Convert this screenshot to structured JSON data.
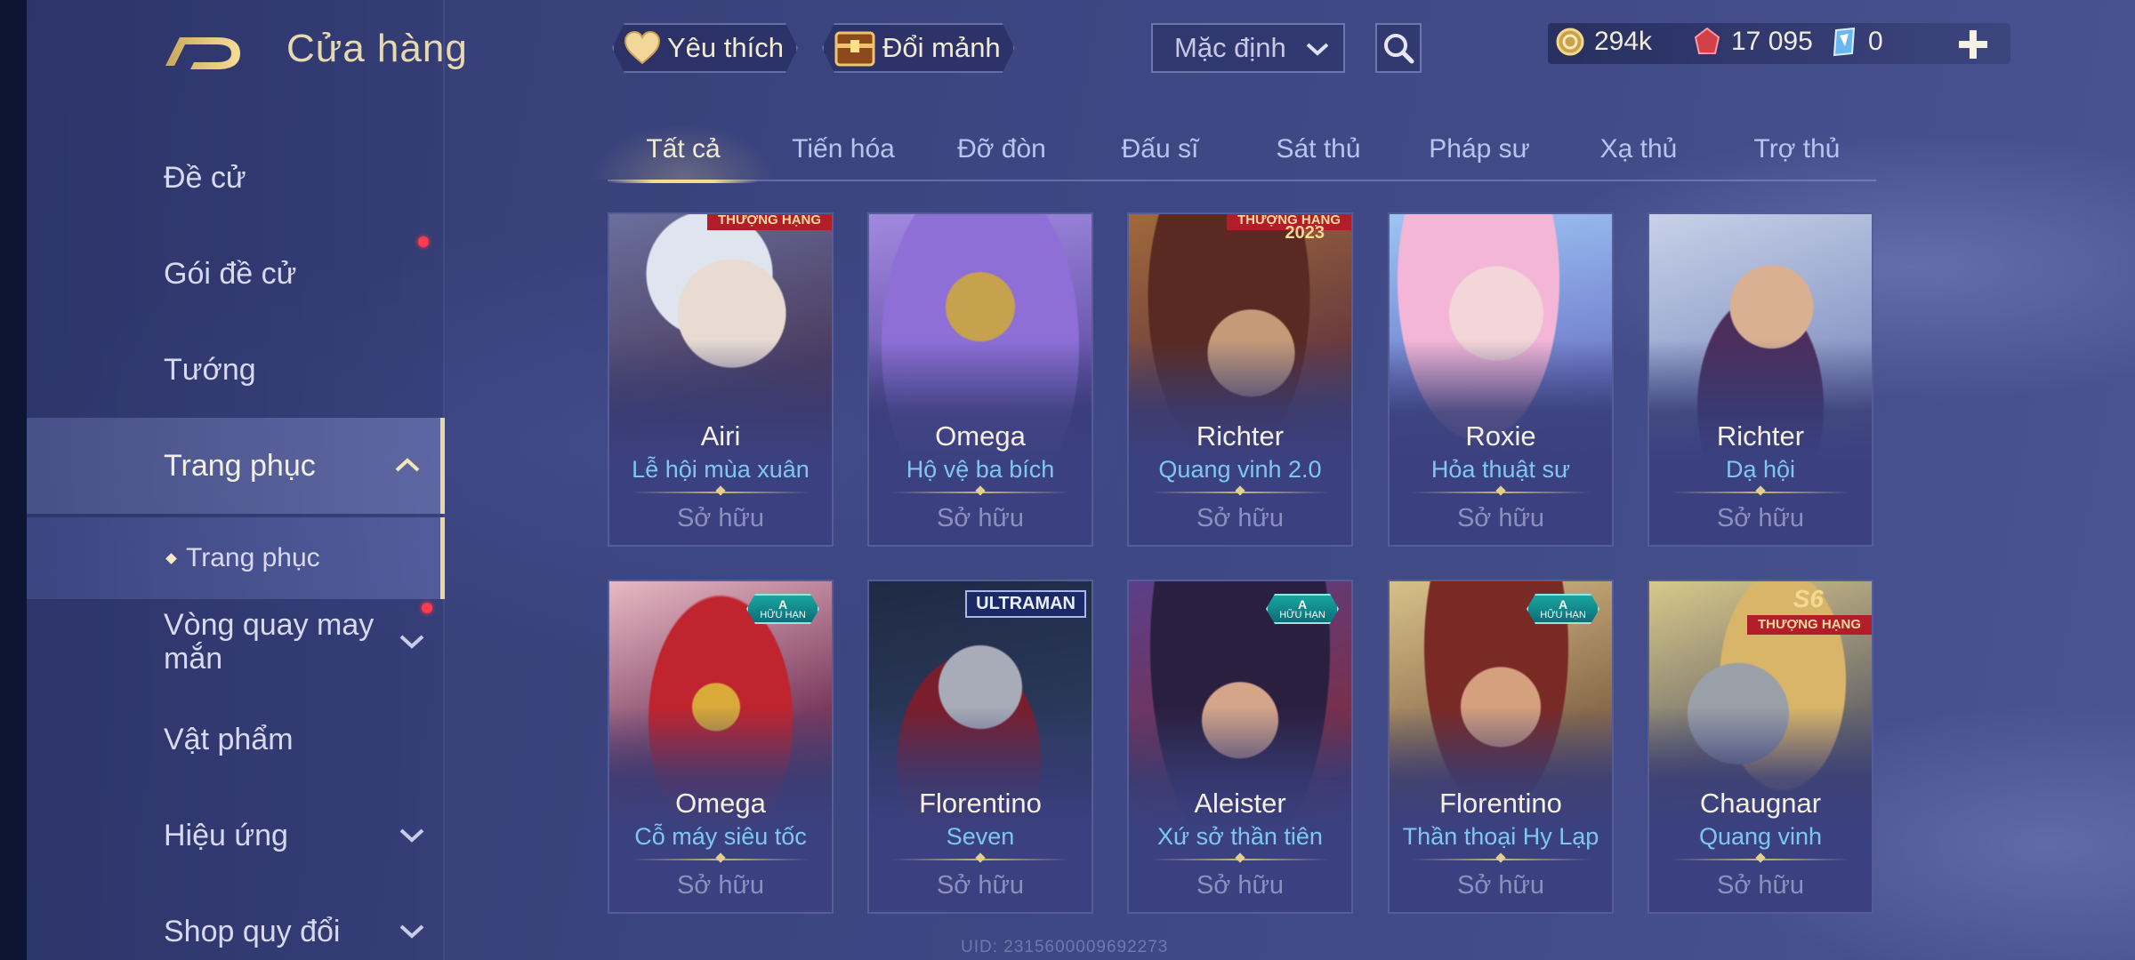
{
  "header": {
    "title": "Cửa hàng",
    "favorite_label": "Yêu thích",
    "exchange_label": "Đổi mảnh",
    "sort_select": "Mặc định"
  },
  "currency": {
    "gold": "294k",
    "vouchers": "17 095",
    "gems": "0"
  },
  "sidebar": {
    "items": [
      {
        "label": "Đề cử"
      },
      {
        "label": "Gói đề cử"
      },
      {
        "label": "Tướng"
      },
      {
        "label": "Trang phục"
      },
      {
        "label": "Trang phục"
      },
      {
        "label": "Vòng quay may mắn"
      },
      {
        "label": "Vật phẩm"
      },
      {
        "label": "Hiệu ứng"
      },
      {
        "label": "Shop quy đổi"
      }
    ]
  },
  "tabs": [
    "Tất cả",
    "Tiến hóa",
    "Đỡ đòn",
    "Đấu sĩ",
    "Sát thủ",
    "Pháp sư",
    "Xạ thủ",
    "Trợ thủ"
  ],
  "cards": [
    {
      "hero": "Airi",
      "skin": "Lễ hội mùa xuân",
      "status": "Sở hữu",
      "ribbon": "THƯỢNG HẠNG"
    },
    {
      "hero": "Omega",
      "skin": "Hộ vệ ba bích",
      "status": "Sở hữu"
    },
    {
      "hero": "Richter",
      "skin": "Quang vinh 2.0",
      "status": "Sở hữu",
      "ribbon": "THƯỢNG HẠNG",
      "ribbon2": "2023"
    },
    {
      "hero": "Roxie",
      "skin": "Hỏa thuật sư",
      "status": "Sở hữu"
    },
    {
      "hero": "Richter",
      "skin": "Dạ hội",
      "status": "Sở hữu"
    },
    {
      "hero": "Omega",
      "skin": "Cỗ máy siêu tốc",
      "status": "Sở hữu",
      "badge_tier": "A",
      "badge_text": "HỮU HẠN"
    },
    {
      "hero": "Florentino",
      "skin": "Seven",
      "status": "Sở hữu",
      "brand": "ULTRAMAN"
    },
    {
      "hero": "Aleister",
      "skin": "Xứ sở thần tiên",
      "status": "Sở hữu",
      "badge_tier": "A",
      "badge_text": "HỮU HẠN"
    },
    {
      "hero": "Florentino",
      "skin": "Thần thoại Hy Lạp",
      "status": "Sở hữu",
      "badge_tier": "A",
      "badge_text": "HỮU HẠN"
    },
    {
      "hero": "Chaugnar",
      "skin": "Quang vinh",
      "status": "Sở hữu",
      "season": "S6",
      "ribbon": "THƯỢNG HẠNG"
    }
  ],
  "footer": {
    "uid": "UID: 2315600009692273"
  },
  "colors": {
    "accent_gold": "#f3dc92",
    "skin_name_blue": "#7fc7f1",
    "notification_red": "#ff3b4e",
    "limited_teal": "#19a6a0"
  }
}
